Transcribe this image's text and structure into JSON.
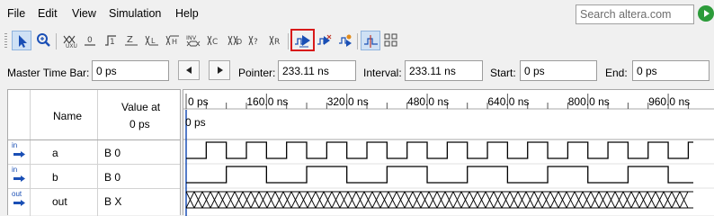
{
  "menu": {
    "items": [
      "File",
      "Edit",
      "View",
      "Simulation",
      "Help"
    ],
    "search_placeholder": "Search altera.com"
  },
  "toolbar": {
    "tools": [
      "selection-tool-icon",
      "zoom-tool-icon",
      "uninitialized-icon",
      "force-low-icon",
      "force-high-icon",
      "high-impedance-icon",
      "weak-low-icon",
      "weak-high-icon",
      "invert-icon",
      "count-value-icon",
      "clock-icon",
      "arbitrary-value-icon",
      "random-value-icon",
      "run-functional-simulation-icon",
      "run-timing-simulation-icon",
      "generate-netlist-icon",
      "snap-to-transition-icon",
      "grid-icon"
    ],
    "highlighted": "run-functional-simulation-icon",
    "highlight_color": "#d81a1a"
  },
  "timebar": {
    "master_label": "Master Time Bar:",
    "master_value": "0 ps",
    "pointer_label": "Pointer:",
    "pointer_value": "233.11 ns",
    "interval_label": "Interval:",
    "interval_value": "233.11 ns",
    "start_label": "Start:",
    "start_value": "0 ps",
    "end_label": "End:",
    "end_value": "0 ps"
  },
  "table": {
    "name_header": "Name",
    "value_header_line1": "Value at",
    "value_header_line2": "0 ps",
    "signals": [
      {
        "icon_label": "in",
        "name": "a",
        "value": "B 0"
      },
      {
        "icon_label": "in",
        "name": "b",
        "value": "B 0"
      },
      {
        "icon_label": "out",
        "name": "out",
        "value": "B X"
      }
    ]
  },
  "waveform": {
    "cursor_label": "0 ps",
    "time_ticks": [
      "0 ps",
      "160.0 ns",
      "320.0 ns",
      "480.0 ns",
      "640.0 ns",
      "800.0 ns",
      "960.0 ns"
    ],
    "tick_values_ns": [
      0,
      160,
      320,
      480,
      640,
      800,
      960
    ],
    "visible_end_ns": 1010,
    "signal_a": {
      "period_ns": 80,
      "starts_low": true,
      "first_edge_ns": 40
    },
    "signal_b": {
      "period_ns": 160,
      "starts_low": true,
      "first_edge_ns": 80
    },
    "signal_out": {
      "state": "unknown"
    },
    "accent": "#1a4fb5"
  }
}
